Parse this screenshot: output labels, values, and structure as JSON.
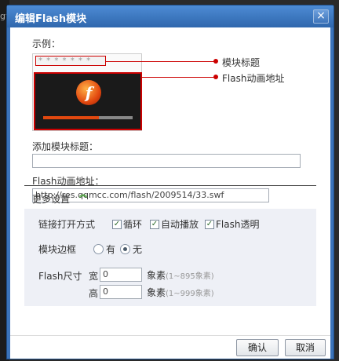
{
  "background": {
    "text": "gt"
  },
  "dialog": {
    "title": "编辑Flash模块",
    "close_icon": "×"
  },
  "example": {
    "label": "示例：",
    "title_placeholder": "* * * * * * *",
    "flash_logo": "f",
    "progress": 0.62
  },
  "annotations": {
    "module_title": "模块标题",
    "flash_address": "Flash动画地址"
  },
  "add_title": {
    "label": "添加模块标题：",
    "value": ""
  },
  "flash_url": {
    "label": "Flash动画地址：",
    "value": "http://res.qqmcc.com/flash/2009514/33.swf"
  },
  "more_settings": {
    "label": "更多设置",
    "link_mode_label": "链接打开方式",
    "options": [
      {
        "label": "循环",
        "checked": true
      },
      {
        "label": "自动播放",
        "checked": true
      },
      {
        "label": "Flash透明",
        "checked": true
      }
    ],
    "border_label": "模块边框",
    "border_options": [
      {
        "label": "有",
        "selected": false
      },
      {
        "label": "无",
        "selected": true
      }
    ],
    "size_label": "Flash尺寸",
    "width_label": "宽",
    "width_value": "0",
    "width_unit": "象素",
    "width_range": "(1~895象素)",
    "height_label": "高",
    "height_value": "0",
    "height_unit": "象素",
    "height_range": "(1~999象素)"
  },
  "footer": {
    "ok": "确认",
    "cancel": "取消"
  },
  "colors": {
    "titlebar": "#3b73b9",
    "annotation_red": "#cc0000",
    "panel_bg": "#eef0f6"
  }
}
